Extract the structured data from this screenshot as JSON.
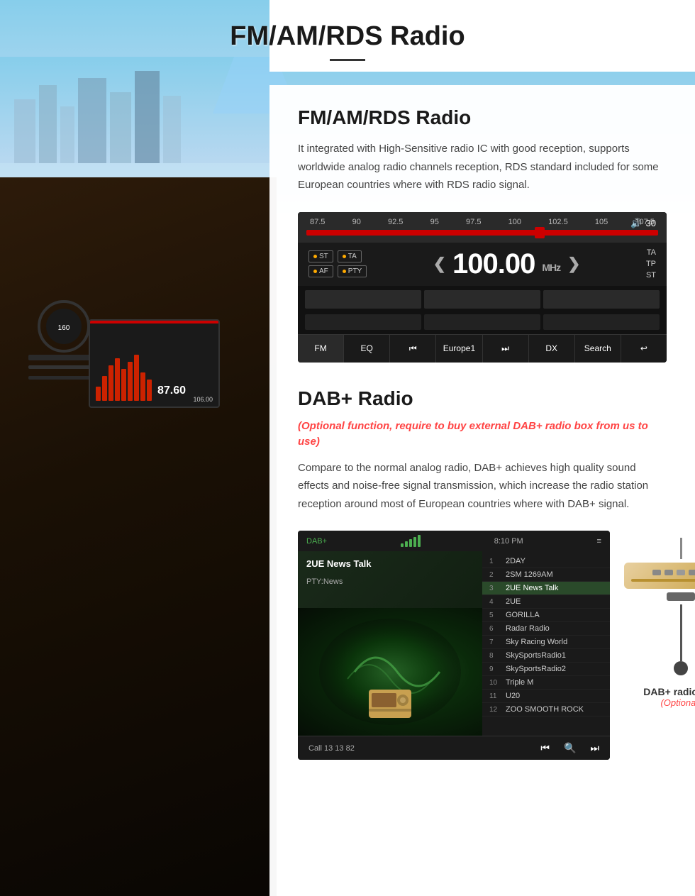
{
  "page": {
    "title": "FM/AM/RDS Radio",
    "title_underline": true
  },
  "fm_section": {
    "title": "FM/AM/RDS Radio",
    "description": "It integrated with High-Sensitive radio IC with good reception, supports worldwide analog radio channels reception, RDS standard included for some European countries where with RDS radio signal."
  },
  "radio_ui": {
    "volume": 30,
    "frequency": "100.00",
    "frequency_unit": "MHz",
    "scale_labels": [
      "87.5",
      "90",
      "92.5",
      "95",
      "97.5",
      "100",
      "102.5",
      "105",
      "107.5"
    ],
    "badges": [
      "ST",
      "TA",
      "AF",
      "PTY"
    ],
    "right_badges": [
      "TA",
      "TP",
      "ST"
    ],
    "buttons": [
      "FM",
      "EQ",
      "⏮",
      "Europe1",
      "⏭",
      "DX",
      "Search",
      "↩"
    ]
  },
  "dab_section": {
    "title": "DAB+ Radio",
    "optional_text": "(Optional function, require to buy external DAB+ radio box from us to use)",
    "description": "Compare to the normal analog radio, DAB+ achieves high quality sound effects and noise-free signal transmission, which increase the radio station reception around most of European countries where with DAB+ signal.",
    "dab_ui": {
      "label": "DAB+",
      "time": "8:10 PM",
      "station": "2UE News Talk",
      "pty": "PTY:News",
      "channels": [
        {
          "num": "1",
          "name": "2DAY"
        },
        {
          "num": "2",
          "name": "2SM 1269AM"
        },
        {
          "num": "3",
          "name": "2UE News Talk",
          "active": true
        },
        {
          "num": "4",
          "name": "2UE"
        },
        {
          "num": "5",
          "name": "GORILLA"
        },
        {
          "num": "6",
          "name": "Radar Radio"
        },
        {
          "num": "7",
          "name": "Sky Racing World"
        },
        {
          "num": "8",
          "name": "SkySportsRadio1"
        },
        {
          "num": "9",
          "name": "SkySportsRadio2"
        },
        {
          "num": "10",
          "name": "Triple M"
        },
        {
          "num": "11",
          "name": "U20"
        },
        {
          "num": "12",
          "name": "ZOO SMOOTH ROCK"
        }
      ],
      "call_sign": "Call 13 13 82",
      "controls": [
        "⏮",
        "🔍",
        "⏭"
      ]
    },
    "dab_box": {
      "label": "DAB+ radio box",
      "sublabel": "(Optional)"
    }
  }
}
